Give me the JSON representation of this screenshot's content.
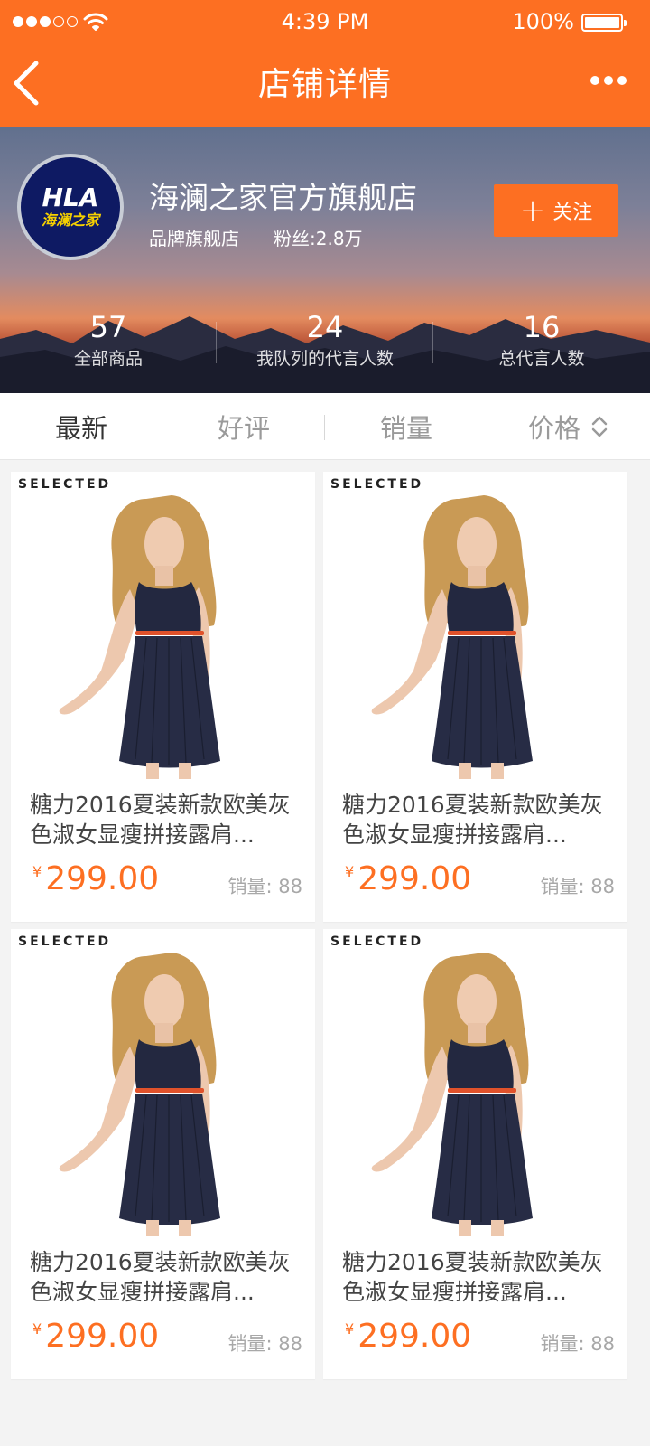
{
  "status_bar": {
    "time": "4:39 PM",
    "battery": "100%"
  },
  "nav": {
    "title": "店铺详情"
  },
  "shop": {
    "logo_main": "HLA",
    "logo_sub": "海澜之家",
    "name": "海澜之家官方旗舰店",
    "type": "品牌旗舰店",
    "fans": "粉丝:2.8万",
    "follow_label": "关注"
  },
  "stats": [
    {
      "value": "57",
      "label": "全部商品"
    },
    {
      "value": "24",
      "label": "我队列的代言人数"
    },
    {
      "value": "16",
      "label": "总代言人数"
    }
  ],
  "sort_tabs": [
    {
      "label": "最新",
      "active": true
    },
    {
      "label": "好评",
      "active": false
    },
    {
      "label": "销量",
      "active": false
    },
    {
      "label": "价格",
      "active": false
    }
  ],
  "products": [
    {
      "badge": "SELECTED",
      "name": "糖力2016夏装新款欧美灰色淑女显瘦拼接露肩...",
      "currency": "¥",
      "price": "299.00",
      "sales": "销量: 88"
    },
    {
      "badge": "SELECTED",
      "name": "糖力2016夏装新款欧美灰色淑女显瘦拼接露肩...",
      "currency": "¥",
      "price": "299.00",
      "sales": "销量: 88"
    },
    {
      "badge": "SELECTED",
      "name": "糖力2016夏装新款欧美灰色淑女显瘦拼接露肩...",
      "currency": "¥",
      "price": "299.00",
      "sales": "销量: 88"
    },
    {
      "badge": "SELECTED",
      "name": "糖力2016夏装新款欧美灰色淑女显瘦拼接露肩...",
      "currency": "¥",
      "price": "299.00",
      "sales": "销量: 88"
    }
  ],
  "colors": {
    "accent": "#fd6f22",
    "logo_bg": "#0e1a63",
    "logo_text": "#f5d000"
  },
  "icons": {
    "back": "chevron-left-icon",
    "more": "more-dots-icon",
    "follow": "plus-icon",
    "sort": "sort-arrows-icon",
    "wifi": "wifi-icon",
    "battery": "battery-icon"
  }
}
